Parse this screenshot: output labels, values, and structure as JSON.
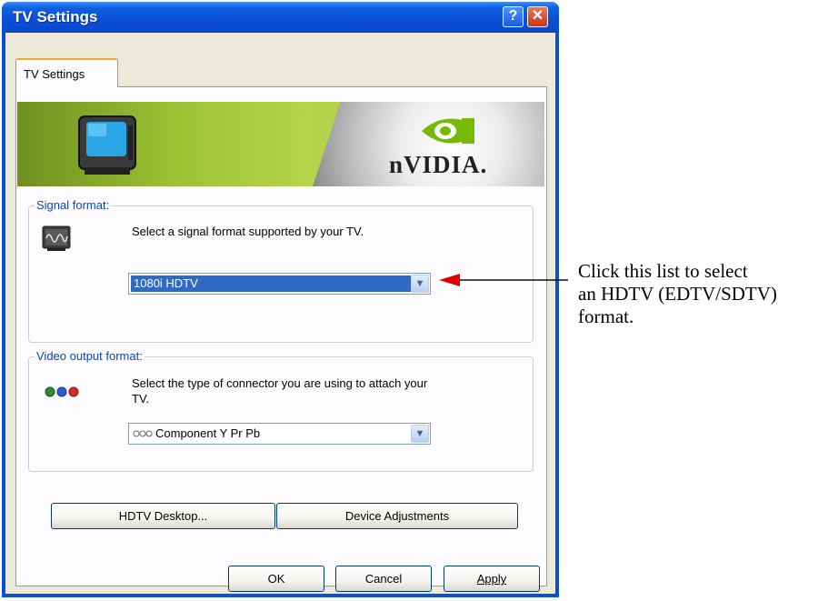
{
  "window": {
    "title": "TV Settings",
    "help_glyph": "?",
    "close_glyph": "✕"
  },
  "tab": {
    "label": "TV Settings"
  },
  "banner": {
    "brand": "nVIDIA."
  },
  "signal_format": {
    "label": "Signal format:",
    "description": "Select a signal format supported by your TV.",
    "selected": "1080i HDTV"
  },
  "video_output": {
    "label": "Video output format:",
    "description_line1": "Select the type of connector you are using to attach your",
    "description_line2": "TV.",
    "selected": "Component Y Pr Pb"
  },
  "buttons": {
    "hdtv_desktop": "HDTV Desktop...",
    "device_adjustments": "Device Adjustments",
    "ok": "OK",
    "cancel": "Cancel",
    "apply": "Apply"
  },
  "annotation": {
    "line1": "Click this list to select",
    "line2": "an HDTV (EDTV/SDTV)",
    "line3": "format."
  },
  "colors": {
    "titlebar": "#0b4fd6",
    "group_label": "#0046d5",
    "selection": "#316ac5",
    "arrow": "#e00000"
  }
}
